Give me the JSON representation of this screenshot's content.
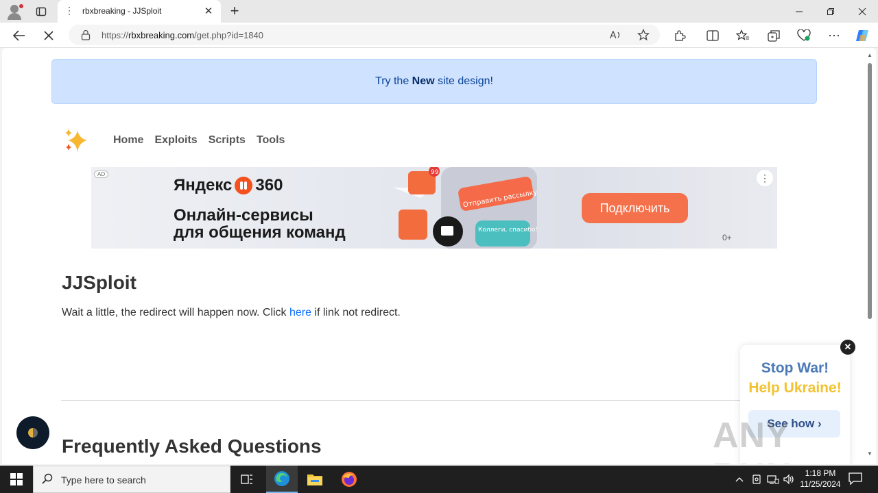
{
  "browser": {
    "tab_title": "rbxbreaking - JJSploit",
    "url_prefix": "https://",
    "url_host": "rbxbreaking.com",
    "url_path": "/get.php?id=1840"
  },
  "banner": {
    "prefix": "Try the ",
    "bold": "New",
    "suffix": " site design!"
  },
  "nav": {
    "items": [
      "Home",
      "Exploits",
      "Scripts",
      "Tools"
    ]
  },
  "ad": {
    "badge": "AD",
    "brand": "Яндекс",
    "brand_num": "360",
    "headline_1": "Онлайн-сервисы",
    "headline_2": "для общения команд",
    "cta": "Подключить",
    "rating": "0+",
    "bubble_1": "Отправить рассылку",
    "bubble_2": "Коллеги, спасибо!",
    "badge_count": "99"
  },
  "content": {
    "title": "JJSploit",
    "redirect_before": "Wait a little, the redirect will happen now. Click ",
    "redirect_link": "here",
    "redirect_after": " if link not redirect.",
    "faq_title": "Frequently Asked Questions"
  },
  "ukraine": {
    "line1": "Stop War!",
    "line2": "Help Ukraine!",
    "button": "See how ›"
  },
  "watermark": "ANY RUN",
  "taskbar": {
    "search_placeholder": "Type here to search",
    "time": "1:18 PM",
    "date": "11/25/2024"
  },
  "colors": {
    "banner_bg": "#cfe2ff",
    "link": "#0d6efd",
    "ad_cta": "#f5714b",
    "ukraine_blue": "#4a79b8",
    "ukraine_yellow": "#f2c230"
  }
}
